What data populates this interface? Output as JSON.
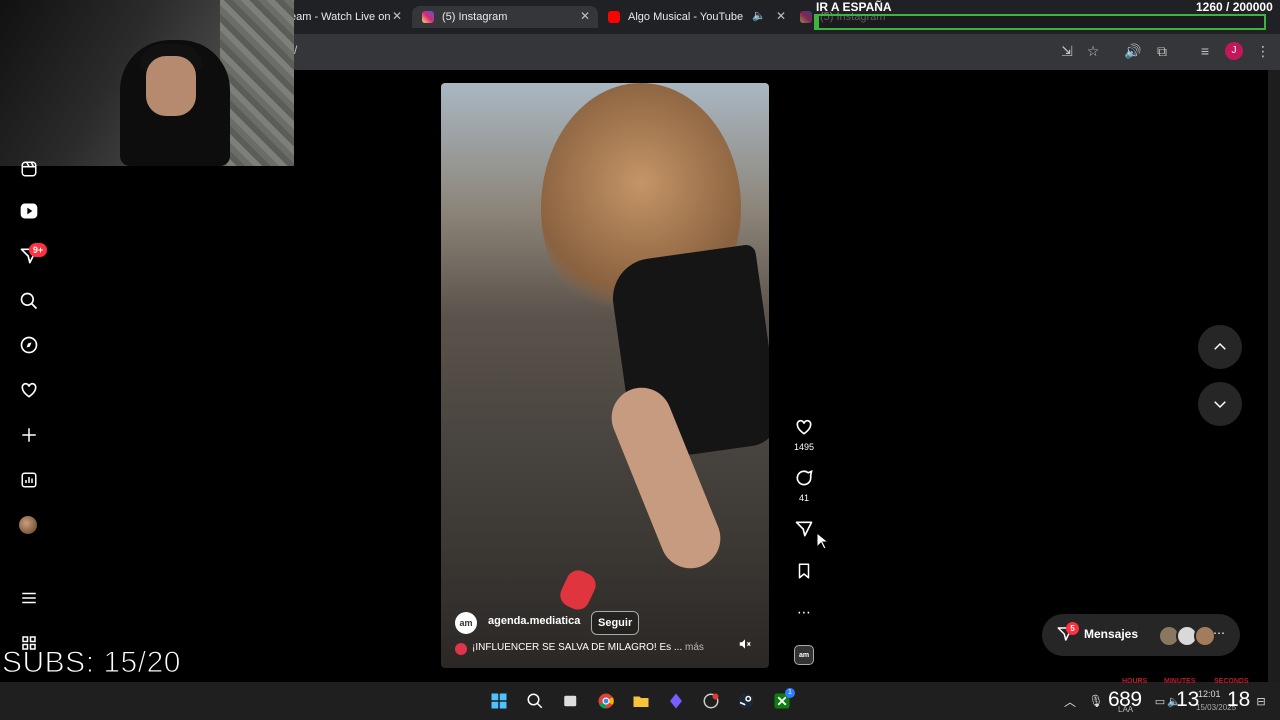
{
  "browser": {
    "tabs": [
      {
        "label": "eam - Watch Live on",
        "active": false
      },
      {
        "label": "(5) Instagram",
        "active": true
      },
      {
        "label": "Algo Musical - YouTube",
        "active": false
      },
      {
        "label": "(5) Instagram",
        "active": false
      }
    ],
    "address_fragment": "/",
    "profile_initial": "J"
  },
  "overlay": {
    "goal_title": "IR A ESPAÑA",
    "goal_count": "1260   / 200000",
    "goal_progress": 0.0063,
    "subs": "SUBS: 15/20"
  },
  "sidebar": {
    "notifications_badge": "9+",
    "items": [
      "reels-icon",
      "notifications-icon",
      "search-icon",
      "explore-icon",
      "heart-icon",
      "create-icon",
      "dashboard-icon",
      "profile-avatar",
      "more-menu-icon",
      "apps-icon"
    ]
  },
  "reel": {
    "username": "agenda.mediatica",
    "avatar_text": "am",
    "follow_label": "Seguir",
    "caption": "¡INFLUENCER SE SALVA DE MILAGRO! Es ...",
    "more_label": "más",
    "likes": "1495",
    "comments": "41",
    "audio_text": "am"
  },
  "messages": {
    "label": "Mensajes",
    "badge": "5"
  },
  "taskbar": {
    "tray_counter_left": "689",
    "tray_counter_mid": "13",
    "tray_counter_right": "18",
    "clock": "12:01",
    "date": "15/03/2025",
    "lang": "LAA",
    "labels_hours": "HOURS",
    "labels_minutes": "MINUTES",
    "labels_seconds": "SECONDS",
    "xbox_badge": "1"
  },
  "colors": {
    "goal_green": "#3fb33f",
    "badge_red": "#ff3040",
    "chrome_dark": "#202124"
  }
}
